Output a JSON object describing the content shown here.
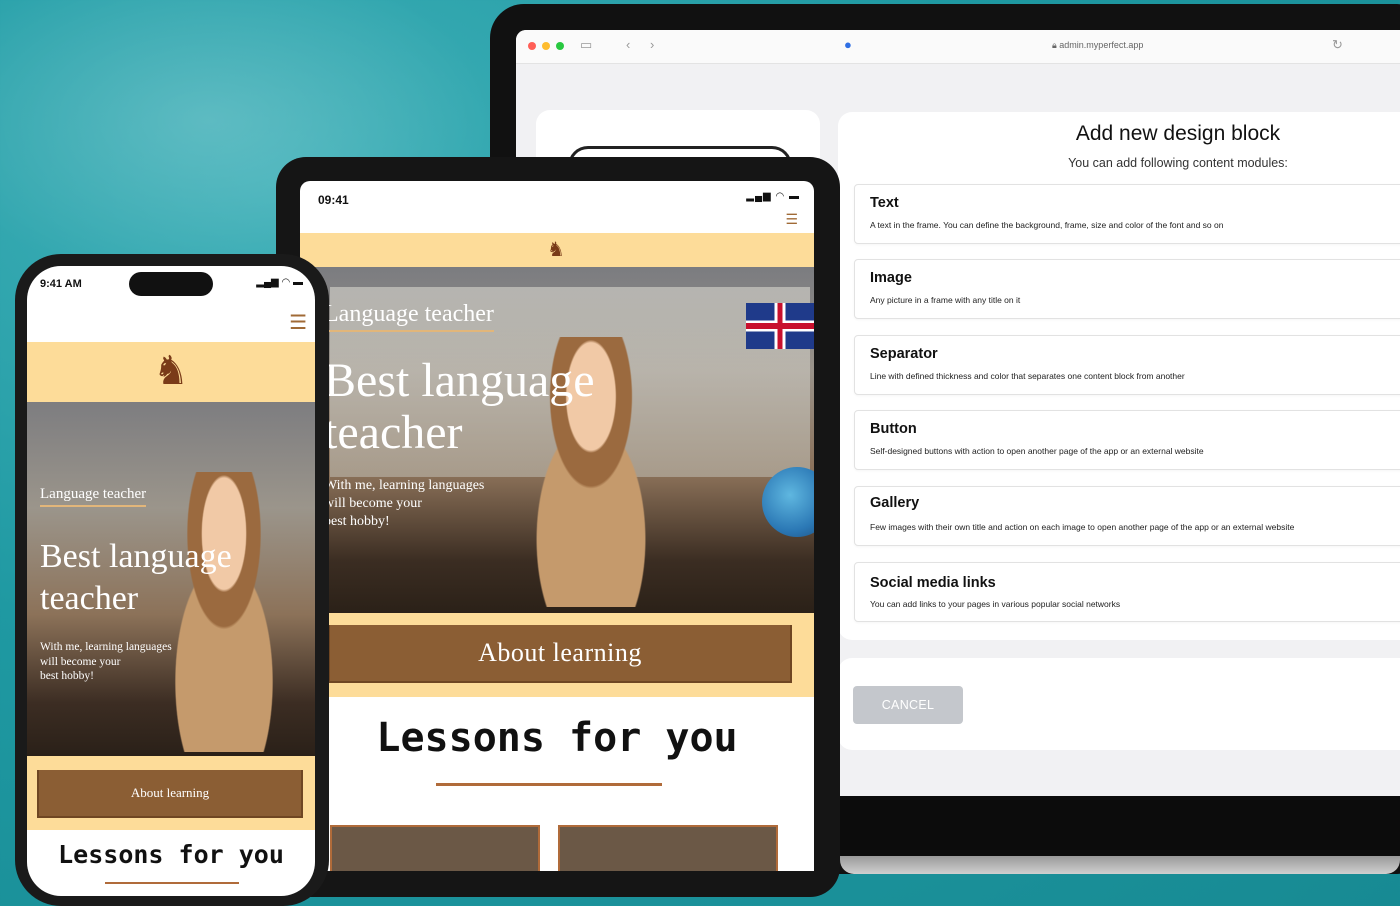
{
  "colors": {
    "background": "#1f99a2",
    "brand_band": "#fddc99",
    "brand_button": "#8b5e34",
    "cancel_button": "#c4c7cc"
  },
  "browser": {
    "url": "admin.myperfect.app",
    "icons": [
      "sidebar-icon",
      "back-icon",
      "forward-icon",
      "shield-icon",
      "lock-icon",
      "reload-icon"
    ]
  },
  "dialog": {
    "title": "Add new design block",
    "subtitle": "You can add following content modules:",
    "modules": [
      {
        "title": "Text",
        "description": "A text in the frame. You can define the background, frame, size and color of the font and so on"
      },
      {
        "title": "Image",
        "description": "Any picture in a frame with any title on it"
      },
      {
        "title": "Separator",
        "description": "Line with defined thickness and color that separates one content block from another"
      },
      {
        "title": "Button",
        "description": "Self-designed buttons with action to open another page of the app or an external website"
      },
      {
        "title": "Gallery",
        "description": "Few images with their own title and action on each image to open another page of the app or an external website"
      },
      {
        "title": "Social media links",
        "description": "You can add links to your pages in various popular social networks"
      }
    ],
    "cancel_label": "CANCEL"
  },
  "tablet": {
    "time": "09:41",
    "hero_label": "Language teacher",
    "hero_title_line1": "Best language",
    "hero_title_line2": "teacher",
    "hero_text_line1": "With me, learning languages",
    "hero_text_line2": "will become your",
    "hero_text_line3": "best hobby!",
    "about_label": "About learning",
    "lessons_title": "Lessons for you"
  },
  "phone": {
    "time": "9:41 AM",
    "hero_label": "Language teacher",
    "hero_title_line1": "Best language",
    "hero_title_line2": "teacher",
    "hero_text_line1": "With me, learning languages",
    "hero_text_line2": "will become your",
    "hero_text_line3": "best hobby!",
    "about_label": "About learning",
    "lessons_title": "Lessons for you"
  }
}
